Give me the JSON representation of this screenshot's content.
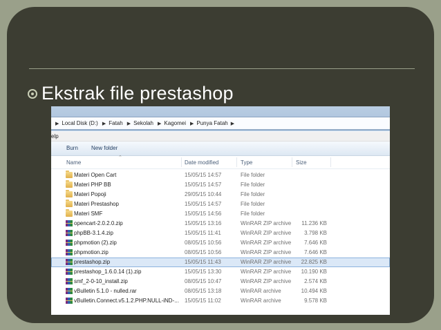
{
  "slide": {
    "bullet_text": "Ekstrak file prestashop"
  },
  "explorer": {
    "breadcrumb": [
      "Local Disk (D:)",
      "Fatah",
      "Sekolah",
      "Kagomei",
      "Punya Fatah"
    ],
    "menu_partial": "elp",
    "toolbar": {
      "burn": "Burn",
      "new_folder": "New folder"
    },
    "columns": {
      "name": "Name",
      "date": "Date modified",
      "type": "Type",
      "size": "Size"
    },
    "files": [
      {
        "name": "Materi Open Cart",
        "date": "15/05/15 14:57",
        "type": "File folder",
        "size": "",
        "icon": "folder-icon"
      },
      {
        "name": "Materi PHP BB",
        "date": "15/05/15 14:57",
        "type": "File folder",
        "size": "",
        "icon": "folder-icon"
      },
      {
        "name": "Materi Popoji",
        "date": "29/05/15 10:44",
        "type": "File folder",
        "size": "",
        "icon": "folder-icon"
      },
      {
        "name": "Materi Prestashop",
        "date": "15/05/15 14:57",
        "type": "File folder",
        "size": "",
        "icon": "folder-icon"
      },
      {
        "name": "Materi SMF",
        "date": "15/05/15 14:56",
        "type": "File folder",
        "size": "",
        "icon": "folder-icon"
      },
      {
        "name": "opencart-2.0.2.0.zip",
        "date": "15/05/15 13:16",
        "type": "WinRAR ZIP archive",
        "size": "11.236 KB",
        "icon": "winrar-archive-icon"
      },
      {
        "name": "phpBB-3.1.4.zip",
        "date": "15/05/15 11:41",
        "type": "WinRAR ZIP archive",
        "size": "3.798 KB",
        "icon": "winrar-archive-icon"
      },
      {
        "name": "phpmotion (2).zip",
        "date": "08/05/15 10:56",
        "type": "WinRAR ZIP archive",
        "size": "7.646 KB",
        "icon": "winrar-archive-icon"
      },
      {
        "name": "phpmotion.zip",
        "date": "08/05/15 10:56",
        "type": "WinRAR ZIP archive",
        "size": "7.646 KB",
        "icon": "winrar-archive-icon"
      },
      {
        "name": "prestashop.zip",
        "date": "15/05/15 11:43",
        "type": "WinRAR ZIP archive",
        "size": "22.825 KB",
        "icon": "winrar-archive-icon",
        "selected": true
      },
      {
        "name": "prestashop_1.6.0.14 (1).zip",
        "date": "15/05/15 13:30",
        "type": "WinRAR ZIP archive",
        "size": "10.190 KB",
        "icon": "winrar-archive-icon"
      },
      {
        "name": "smf_2-0-10_install.zip",
        "date": "08/05/15 10:47",
        "type": "WinRAR ZIP archive",
        "size": "2.574 KB",
        "icon": "winrar-archive-icon"
      },
      {
        "name": "vBulletin 5.1.0 - nulled.rar",
        "date": "08/05/15 13:18",
        "type": "WinRAR archive",
        "size": "10.494 KB",
        "icon": "winrar-archive-icon"
      },
      {
        "name": "vBulletin.Connect.v5.1.2.PHP.NULL-iND-...",
        "date": "15/05/15 11:02",
        "type": "WinRAR archive",
        "size": "9.578 KB",
        "icon": "winrar-archive-icon"
      }
    ]
  },
  "colors": {
    "slide_bg": "#9aa08a",
    "panel": "#3c3d32",
    "selection": "#dbe8f7"
  }
}
